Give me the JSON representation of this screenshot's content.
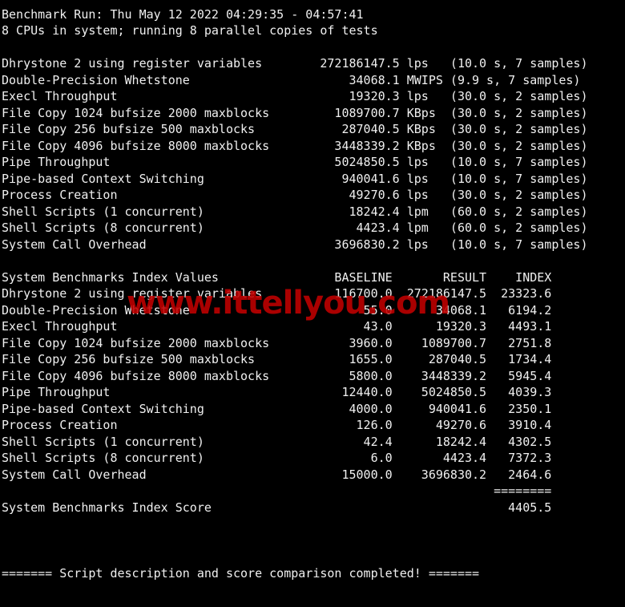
{
  "terminal": {
    "background_color": "#000000",
    "text_color": "#f0f0f0",
    "rule_top": "-------------------------------------------------------------------------",
    "header": {
      "run_line": "Benchmark Run: Thu May 12 2022 04:29:35 - 04:57:41",
      "cpu_line": "8 CPUs in system; running 8 parallel copies of tests"
    },
    "results": {
      "rows": [
        {
          "name": "Dhrystone 2 using register variables",
          "value": "272186147.5",
          "unit": "lps",
          "timing": "(10.0 s, 7 samples)"
        },
        {
          "name": "Double-Precision Whetstone",
          "value": "34068.1",
          "unit": "MWIPS",
          "timing": "(9.9 s, 7 samples)"
        },
        {
          "name": "Execl Throughput",
          "value": "19320.3",
          "unit": "lps",
          "timing": "(30.0 s, 2 samples)"
        },
        {
          "name": "File Copy 1024 bufsize 2000 maxblocks",
          "value": "1089700.7",
          "unit": "KBps",
          "timing": "(30.0 s, 2 samples)"
        },
        {
          "name": "File Copy 256 bufsize 500 maxblocks",
          "value": "287040.5",
          "unit": "KBps",
          "timing": "(30.0 s, 2 samples)"
        },
        {
          "name": "File Copy 4096 bufsize 8000 maxblocks",
          "value": "3448339.2",
          "unit": "KBps",
          "timing": "(30.0 s, 2 samples)"
        },
        {
          "name": "Pipe Throughput",
          "value": "5024850.5",
          "unit": "lps",
          "timing": "(10.0 s, 7 samples)"
        },
        {
          "name": "Pipe-based Context Switching",
          "value": "940041.6",
          "unit": "lps",
          "timing": "(10.0 s, 7 samples)"
        },
        {
          "name": "Process Creation",
          "value": "49270.6",
          "unit": "lps",
          "timing": "(30.0 s, 2 samples)"
        },
        {
          "name": "Shell Scripts (1 concurrent)",
          "value": "18242.4",
          "unit": "lpm",
          "timing": "(60.0 s, 2 samples)"
        },
        {
          "name": "Shell Scripts (8 concurrent)",
          "value": "4423.4",
          "unit": "lpm",
          "timing": "(60.0 s, 2 samples)"
        },
        {
          "name": "System Call Overhead",
          "value": "3696830.2",
          "unit": "lps",
          "timing": "(10.0 s, 7 samples)"
        }
      ]
    },
    "index": {
      "title": "System Benchmarks Index Values",
      "col_baseline": "BASELINE",
      "col_result": "RESULT",
      "col_index": "INDEX",
      "rows": [
        {
          "name": "Dhrystone 2 using register variables",
          "baseline": "116700.0",
          "result": "272186147.5",
          "index": "23323.6"
        },
        {
          "name": "Double-Precision Whetstone",
          "baseline": "55.0",
          "result": "34068.1",
          "index": "6194.2"
        },
        {
          "name": "Execl Throughput",
          "baseline": "43.0",
          "result": "19320.3",
          "index": "4493.1"
        },
        {
          "name": "File Copy 1024 bufsize 2000 maxblocks",
          "baseline": "3960.0",
          "result": "1089700.7",
          "index": "2751.8"
        },
        {
          "name": "File Copy 256 bufsize 500 maxblocks",
          "baseline": "1655.0",
          "result": "287040.5",
          "index": "1734.4"
        },
        {
          "name": "File Copy 4096 bufsize 8000 maxblocks",
          "baseline": "5800.0",
          "result": "3448339.2",
          "index": "5945.4"
        },
        {
          "name": "Pipe Throughput",
          "baseline": "12440.0",
          "result": "5024850.5",
          "index": "4039.3"
        },
        {
          "name": "Pipe-based Context Switching",
          "baseline": "4000.0",
          "result": "940041.6",
          "index": "2350.1"
        },
        {
          "name": "Process Creation",
          "baseline": "126.0",
          "result": "49270.6",
          "index": "3910.4"
        },
        {
          "name": "Shell Scripts (1 concurrent)",
          "baseline": "42.4",
          "result": "18242.4",
          "index": "4302.5"
        },
        {
          "name": "Shell Scripts (8 concurrent)",
          "baseline": "6.0",
          "result": "4423.4",
          "index": "7372.3"
        },
        {
          "name": "System Call Overhead",
          "baseline": "15000.0",
          "result": "3696830.2",
          "index": "2464.6"
        }
      ],
      "separator": "========",
      "score_label": "System Benchmarks Index Score",
      "score_value": "4405.5"
    },
    "footer": {
      "completed_line": "======= Script description and score comparison completed! ======="
    },
    "watermark": {
      "text": "www.ittellyou.com",
      "color": "#c20000"
    }
  }
}
